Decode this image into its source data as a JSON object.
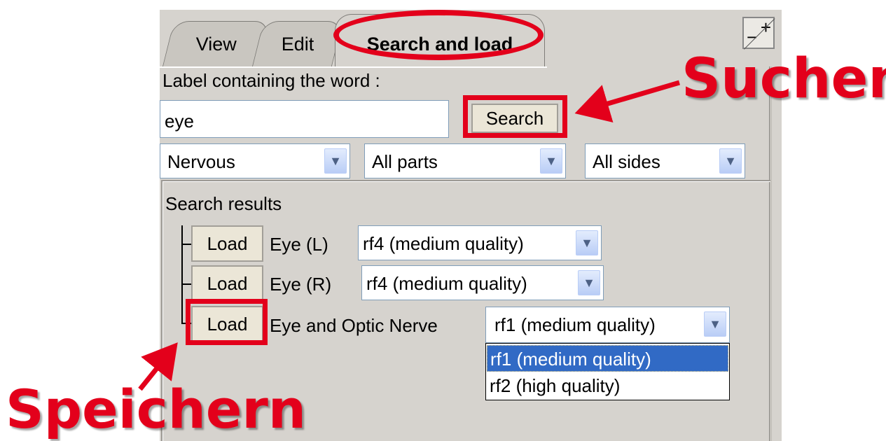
{
  "tabs": {
    "view": "View",
    "edit": "Edit",
    "search_load": "Search and load"
  },
  "window": {
    "maximize_plus": "+",
    "maximize_minus": "−"
  },
  "search": {
    "label": "Label containing the word :",
    "value": "eye",
    "button": "Search"
  },
  "filters": {
    "system": "Nervous",
    "parts": "All parts",
    "sides": "All sides"
  },
  "results": {
    "heading": "Search results",
    "load_label": "Load",
    "rows": [
      {
        "name": "Eye (L)",
        "quality": "rf4 (medium quality)"
      },
      {
        "name": "Eye (R)",
        "quality": "rf4 (medium quality)"
      },
      {
        "name": "Eye and Optic Nerve",
        "quality": "rf1 (medium quality)"
      }
    ],
    "options": [
      "rf1 (medium quality)",
      "rf2 (high quality)"
    ]
  },
  "annotations": {
    "search": "Suchen",
    "save": "Speichern"
  },
  "colors": {
    "highlight": "#e3001b",
    "selection": "#316ac5"
  },
  "icons": {
    "dropdown": "chevron-down-icon",
    "tree": "tree-connector"
  }
}
